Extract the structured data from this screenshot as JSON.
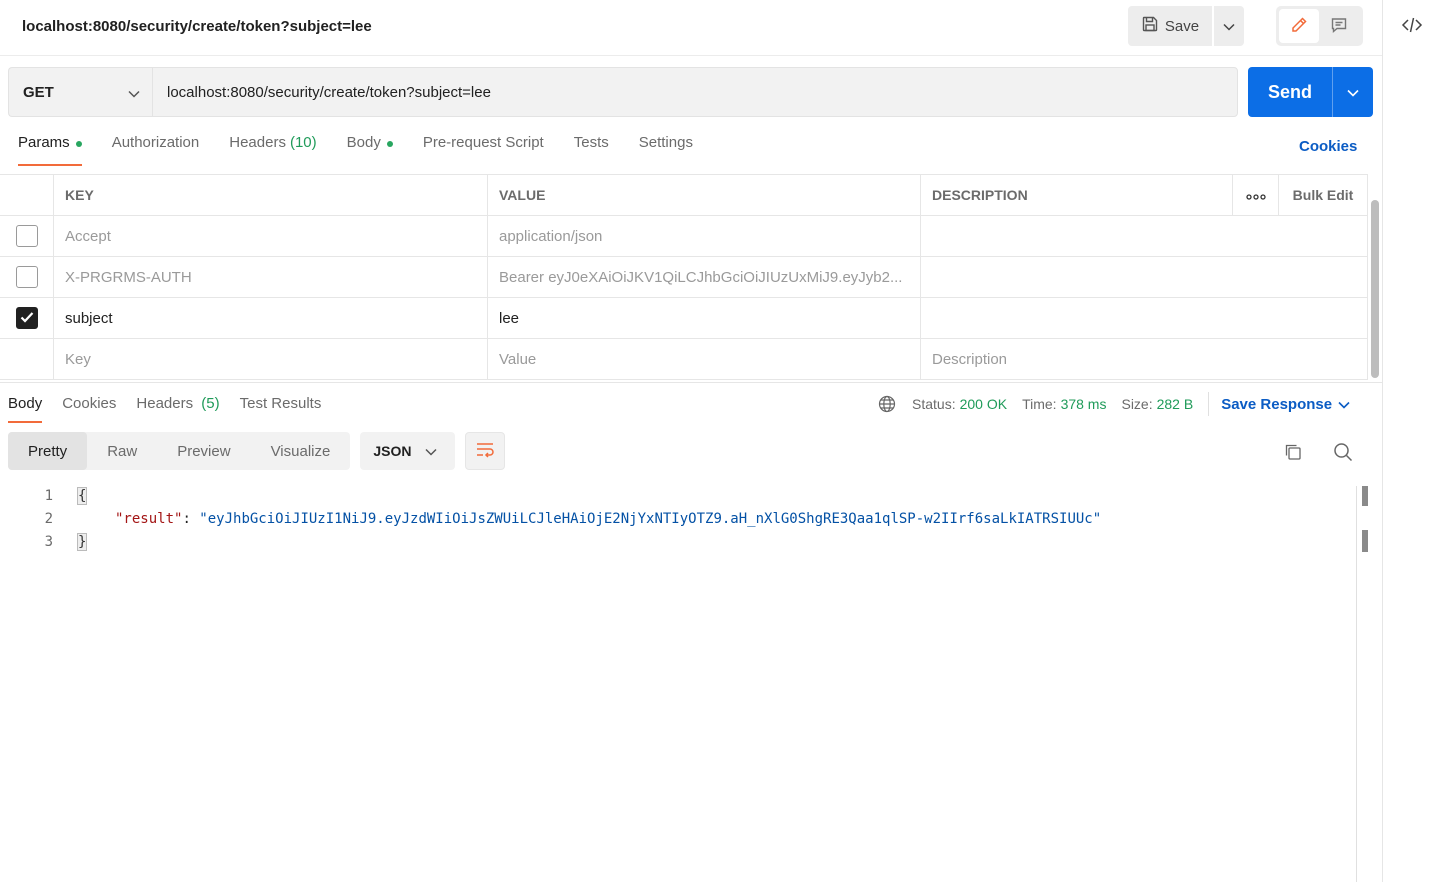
{
  "header": {
    "title": "localhost:8080/security/create/token?subject=lee",
    "save_label": "Save"
  },
  "request": {
    "method": "GET",
    "url": "localhost:8080/security/create/token?subject=lee",
    "send_label": "Send"
  },
  "tabs": {
    "params": "Params",
    "authorization": "Authorization",
    "headers": "Headers",
    "headers_count": "(10)",
    "body": "Body",
    "prerequest": "Pre-request Script",
    "tests": "Tests",
    "settings": "Settings",
    "cookies": "Cookies"
  },
  "params_table": {
    "columns": {
      "key": "KEY",
      "value": "VALUE",
      "description": "DESCRIPTION",
      "bulk_edit": "Bulk Edit"
    },
    "rows": [
      {
        "key": "Accept",
        "value": "application/json",
        "description": "",
        "checked": false
      },
      {
        "key": "X-PRGRMS-AUTH",
        "value": "Bearer eyJ0eXAiOiJKV1QiLCJhbGciOiJIUzUxMiJ9.eyJyb2...",
        "description": "",
        "checked": false
      },
      {
        "key": "subject",
        "value": "lee",
        "description": "",
        "checked": true
      }
    ],
    "placeholder": {
      "key": "Key",
      "value": "Value",
      "description": "Description"
    }
  },
  "response": {
    "tabs": {
      "body": "Body",
      "cookies": "Cookies",
      "headers": "Headers",
      "headers_count": "(5)",
      "test_results": "Test Results"
    },
    "status_label": "Status:",
    "status_value": "200 OK",
    "time_label": "Time:",
    "time_value": "378 ms",
    "size_label": "Size:",
    "size_value": "282 B",
    "save_response": "Save Response",
    "views": {
      "pretty": "Pretty",
      "raw": "Raw",
      "preview": "Preview",
      "visualize": "Visualize"
    },
    "format": "JSON",
    "lines": {
      "n1": "1",
      "n2": "2",
      "n3": "3",
      "open": "{",
      "key": "\"result\"",
      "colon": ": ",
      "value": "\"eyJhbGciOiJIUzI1NiJ9.eyJzdWIiOiJsZWUiLCJleHAiOjE2NjYxNTIyOTZ9.aH_nXlG0ShgRE3Qaa1qlSP-w2IIrf6saLkIATRSIUUc\"",
      "close": "}"
    }
  },
  "colors": {
    "accent_orange": "#f26b3a",
    "send_blue": "#0c6ee6",
    "status_green": "#209b5a",
    "link_blue": "#0b5cc4"
  },
  "icons": {
    "save": "floppy-disk-icon",
    "edit": "pencil-icon",
    "comment": "comment-icon",
    "code": "code-icon",
    "globe": "globe-icon",
    "copy": "copy-icon",
    "search": "search-icon",
    "wrap": "wrap-lines-icon"
  }
}
